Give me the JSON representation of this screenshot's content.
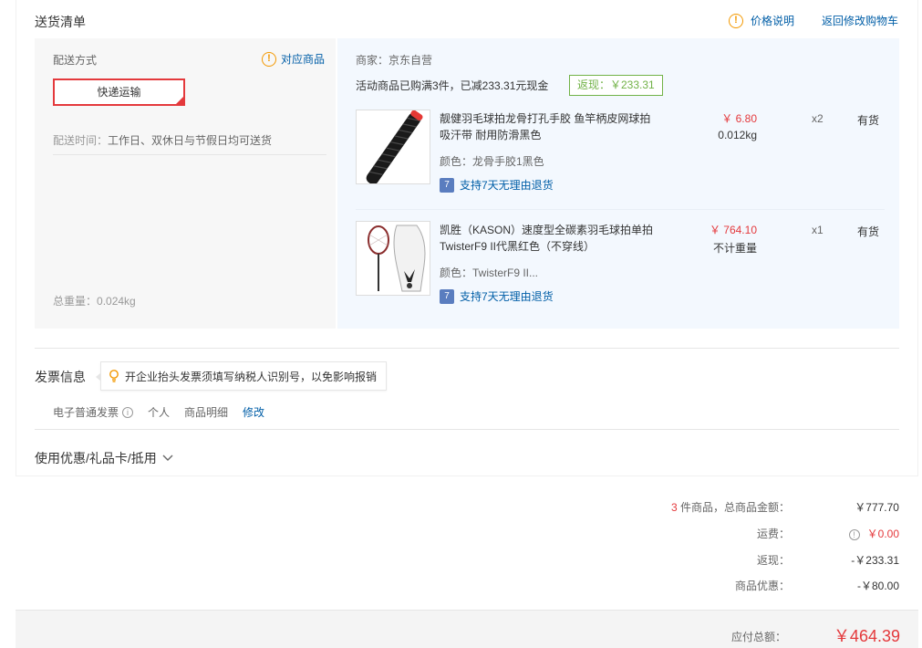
{
  "section": {
    "title": "送货清单"
  },
  "header_links": {
    "price_info": "价格说明",
    "back_to_cart": "返回修改购物车"
  },
  "shipping": {
    "method_label": "配送方式",
    "correspond_label": "对应商品",
    "method_selected": "快递运输",
    "time_prefix": "配送时间：",
    "time_value": "工作日、双休日与节假日均可送货",
    "total_weight_label": "总重量：",
    "total_weight": "0.024kg"
  },
  "seller": {
    "label": "商家：京东自营",
    "promo": "活动商品已购满3件，已减233.31元现金",
    "rebate_tag": "返现：￥233.31"
  },
  "items": [
    {
      "name": "靓健羽毛球拍龙骨打孔手胶 鱼竿柄皮网球拍吸汗带 耐用防滑黑色",
      "color": "颜色：龙骨手胶1黑色",
      "return_policy": "支持7天无理由退货",
      "price": "￥ 6.80",
      "weight": "0.012kg",
      "qty": "x2",
      "stock": "有货"
    },
    {
      "name": "凯胜（KASON）速度型全碳素羽毛球拍单拍TwisterF9 II代黑红色（不穿线）",
      "color": "颜色：TwisterF9 II...",
      "return_policy": "支持7天无理由退货",
      "price": "￥ 764.10",
      "weight": "不计重量",
      "qty": "x1",
      "stock": "有货"
    }
  ],
  "invoice": {
    "title": "发票信息",
    "tip": "开企业抬头发票须填写纳税人识别号，以免影响报销",
    "type": "电子普通发票",
    "header": "个人",
    "content": "商品明细",
    "edit": "修改"
  },
  "coupon": {
    "label": "使用优惠/礼品卡/抵用"
  },
  "summary": {
    "count": "3",
    "count_suffix": " 件商品，总商品金额：",
    "goods_total": "￥777.70",
    "freight_label": "运费：",
    "freight": "￥0.00",
    "rebate_label": "返现：",
    "rebate": "-￥233.31",
    "discount_label": "商品优惠：",
    "discount": "-￥80.00",
    "payable_label": "应付总额：",
    "payable": "￥464.39"
  },
  "colors": {
    "accent_red": "#e4393c",
    "link_blue": "#005ea7",
    "warn_orange": "#f39800",
    "rebate_green": "#71b247"
  },
  "icons": [
    "warning-icon",
    "info-icon",
    "bulb-icon",
    "return-icon",
    "chevron-down-icon"
  ]
}
